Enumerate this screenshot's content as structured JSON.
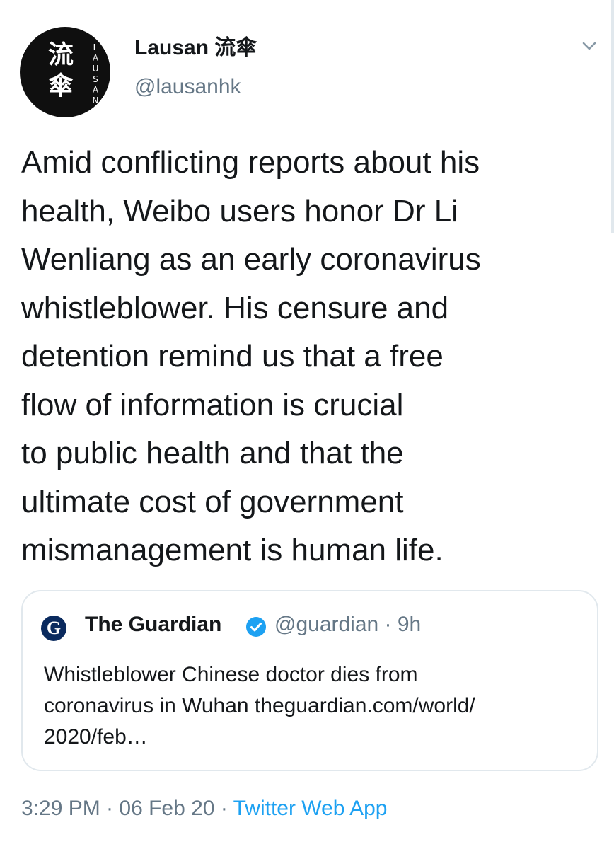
{
  "author": {
    "display_name": "Lausan 流傘",
    "handle": "@lausanhk",
    "avatar": {
      "glyphs": [
        "流",
        "傘"
      ],
      "letters": [
        "L",
        "A",
        "U",
        "S",
        "A",
        "N"
      ],
      "background": "#0f0f0f"
    }
  },
  "menu": {
    "icon": "chevron-down-icon"
  },
  "tweet": {
    "lines": [
      "Amid conflicting reports about his",
      "health, Weibo users honor Dr Li",
      "Wenliang as an early coronavirus",
      "whistleblower. His censure and",
      "detention remind us that a free",
      "flow of information is crucial",
      "to public health and that the",
      "ultimate cost of government",
      "mismanagement is human life."
    ]
  },
  "quoted_tweet": {
    "logo_letter": "G",
    "name": "The Guardian",
    "verified_icon": "verified-badge-icon",
    "handle_time": "@guardian · 9h",
    "lines": [
      "Whistleblower Chinese doctor dies from",
      "coronavirus in Wuhan theguardian.com/world/",
      "2020/feb…"
    ]
  },
  "meta": {
    "timestamp": "3:29 PM · 06 Feb 20 · ",
    "source": "Twitter Web App"
  },
  "colors": {
    "text": "#14171a",
    "secondary": "#657786",
    "link": "#1da1f2",
    "border": "#e1e8ed",
    "verified": "#1da1f2",
    "guardian": "#0a2a5e"
  }
}
